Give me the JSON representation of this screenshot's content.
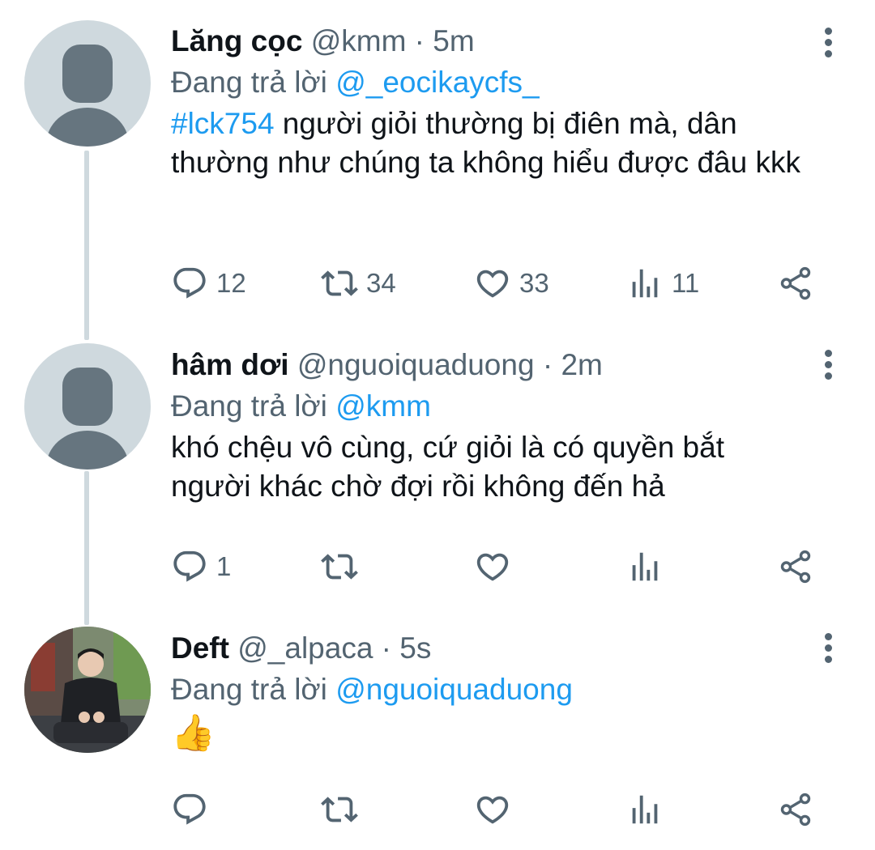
{
  "tweets": [
    {
      "name": "Lăng cọc",
      "handle": "@kmm",
      "time": "5m",
      "reply_prefix": "Đang trả lời",
      "reply_to": "@_eocikaycfs_",
      "hashtag": "#lck754",
      "text": " người giỏi thường bị điên mà, dân thường như chúng ta không hiểu được đâu kkk",
      "counts": {
        "reply": "12",
        "retweet": "34",
        "like": "33",
        "views": "11"
      },
      "avatar": "default-avatar"
    },
    {
      "name": "hâm dơi",
      "handle": "@nguoiquaduong",
      "time": "2m",
      "reply_prefix": "Đang trả lời",
      "reply_to": "@kmm",
      "text": "khó chệu vô cùng, cứ giỏi là có quyền bắt người khác chờ đợi rồi không đến hả",
      "counts": {
        "reply": "1",
        "retweet": "",
        "like": "",
        "views": ""
      },
      "avatar": "default-avatar"
    },
    {
      "name": "Deft",
      "handle": "@_alpaca",
      "time": "5s",
      "reply_prefix": "Đang trả lời",
      "reply_to": "@nguoiquaduong",
      "text": "👍",
      "counts": {
        "reply": "",
        "retweet": "",
        "like": "",
        "views": ""
      },
      "avatar": "photo-avatar"
    }
  ],
  "separator": " · ",
  "icons": {
    "reply": "reply-icon",
    "retweet": "retweet-icon",
    "like": "heart-icon",
    "views": "views-icon",
    "share": "share-icon",
    "more": "more-vertical-icon"
  },
  "colors": {
    "link": "#1d9bf0",
    "secondary_text": "#536471",
    "primary_text": "#0f1419",
    "thread_line": "#cfd9de"
  }
}
